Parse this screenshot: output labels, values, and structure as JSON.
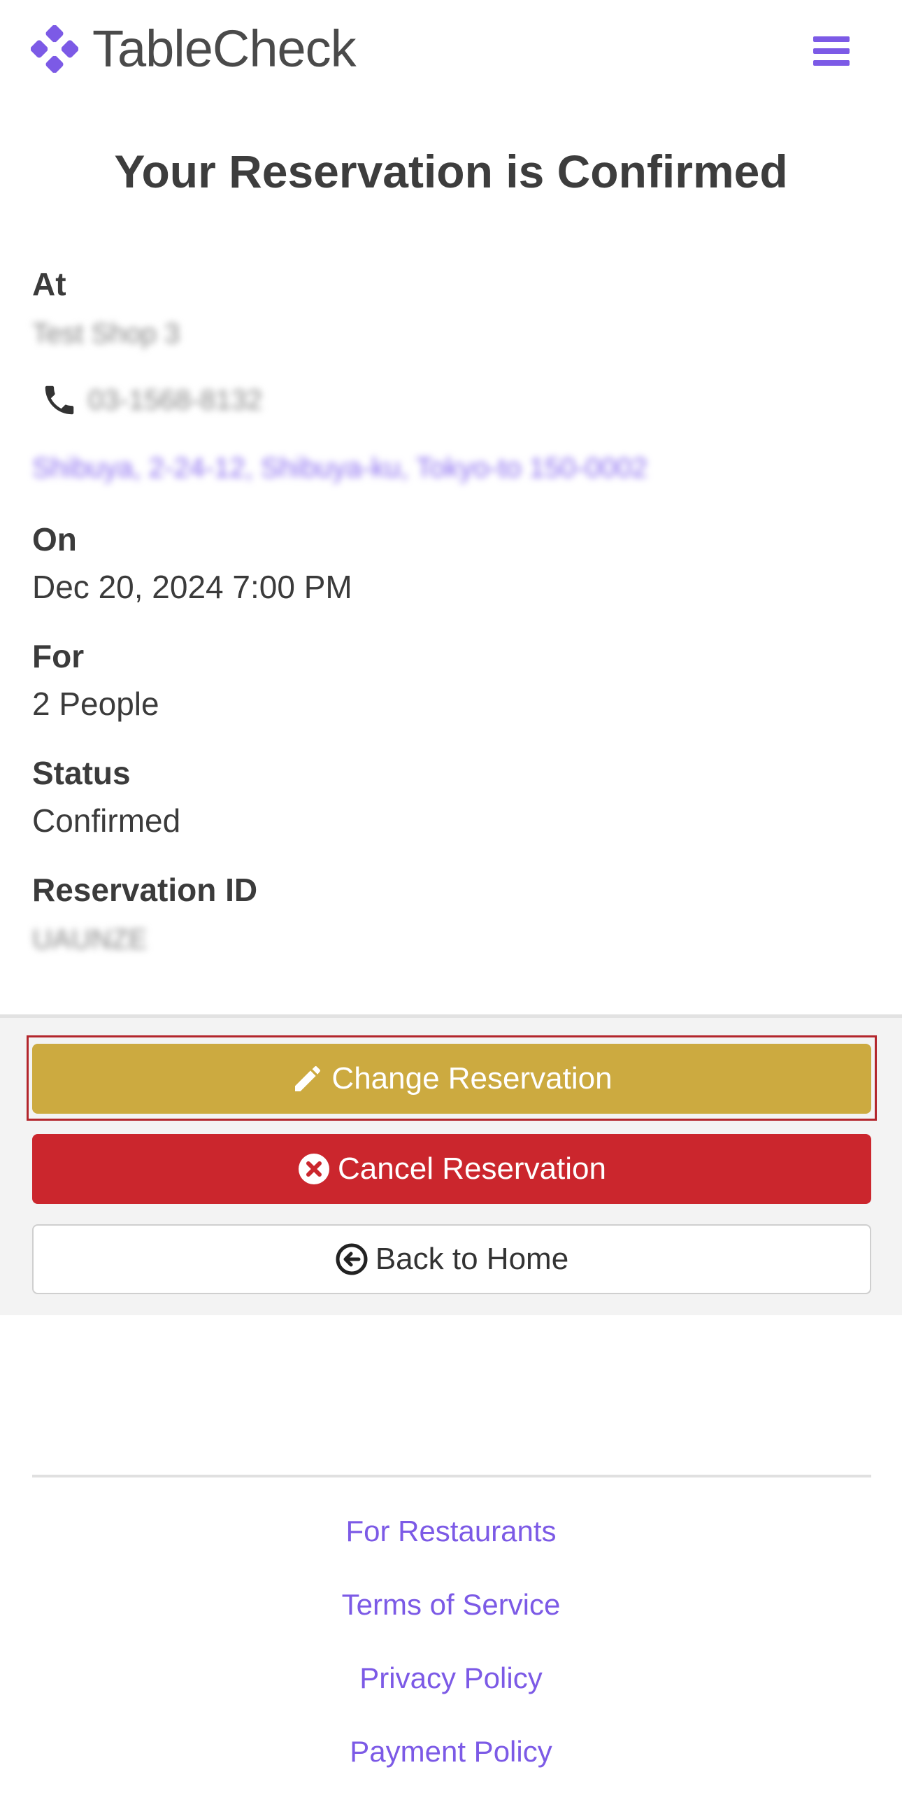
{
  "header": {
    "brand_name": "TableCheck",
    "brand_color": "#7c5ae6",
    "menu_icon": "hamburger-menu-icon"
  },
  "page": {
    "title": "Your Reservation is Confirmed"
  },
  "details": {
    "at_label": "At",
    "restaurant_name": "Test Shop 3",
    "phone": "03-1568-8132",
    "address": "Shibuya, 2-24-12, Shibuya-ku, Tokyo-to 150-0002",
    "on_label": "On",
    "datetime": "Dec 20, 2024 7:00 PM",
    "for_label": "For",
    "party_size": "2 People",
    "status_label": "Status",
    "status": "Confirmed",
    "reservation_id_label": "Reservation ID",
    "reservation_id": "UAUNZE"
  },
  "actions": {
    "change_label": "Change Reservation",
    "cancel_label": "Cancel Reservation",
    "home_label": "Back to Home",
    "change_color": "#ccaa40",
    "cancel_color": "#cb262d"
  },
  "footer": {
    "links": [
      "For Restaurants",
      "Terms of Service",
      "Privacy Policy",
      "Payment Policy"
    ]
  }
}
